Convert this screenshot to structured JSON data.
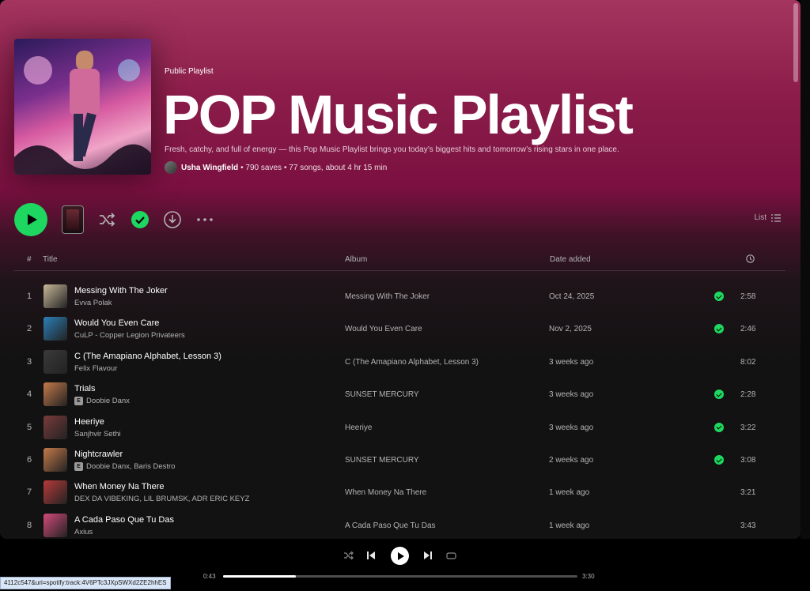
{
  "header": {
    "type_label": "Public Playlist",
    "title": "POP Music Playlist",
    "description": "Fresh, catchy, and full of energy — this Pop Music Playlist brings you today’s biggest hits and tomorrow’s rising stars in one place.",
    "owner": "Usha Wingfield",
    "saves": "• 790 saves",
    "songs": "• 77 songs, about 4 hr 15 min"
  },
  "actions": {
    "view_label": "List"
  },
  "table_head": {
    "num": "#",
    "title": "Title",
    "album": "Album",
    "date": "Date added"
  },
  "tracks": [
    {
      "num": "1",
      "name": "Messing With The Joker",
      "artist": "Evva Polak",
      "explicit": false,
      "album": "Messing With The Joker",
      "date": "Oct 24, 2025",
      "saved": true,
      "duration": "2:58",
      "thumb": "#c9b89a"
    },
    {
      "num": "2",
      "name": "Would You Even Care",
      "artist": "CuLP - Copper Legion Privateers",
      "explicit": false,
      "album": "Would You Even Care",
      "date": "Nov 2, 2025",
      "saved": true,
      "duration": "2:46",
      "thumb": "#2b7fb8"
    },
    {
      "num": "3",
      "name": "C (The Amapiano Alphabet, Lesson 3)",
      "artist": "Felix Flavour",
      "explicit": false,
      "album": "C (The Amapiano Alphabet, Lesson 3)",
      "date": "3 weeks ago",
      "saved": false,
      "duration": "8:02",
      "thumb": "#3a3a3a"
    },
    {
      "num": "4",
      "name": "Trials",
      "artist": "Doobie Danx",
      "explicit": true,
      "album": "SUNSET MERCURY",
      "date": "3 weeks ago",
      "saved": true,
      "duration": "2:28",
      "thumb": "#c47a4a"
    },
    {
      "num": "5",
      "name": "Heeriye",
      "artist": "Sanjhvir Sethi",
      "explicit": false,
      "album": "Heeriye",
      "date": "3 weeks ago",
      "saved": true,
      "duration": "3:22",
      "thumb": "#7a3b3b"
    },
    {
      "num": "6",
      "name": "Nightcrawler",
      "artist": "Doobie Danx, Baris Destro",
      "explicit": true,
      "album": "SUNSET MERCURY",
      "date": "2 weeks ago",
      "saved": true,
      "duration": "3:08",
      "thumb": "#c47a4a"
    },
    {
      "num": "7",
      "name": "When Money Na There",
      "artist": "DEX DA VIBEKING, LIL BRUMSK, ADR ERIC KEYZ",
      "explicit": false,
      "album": "When Money Na There",
      "date": "1 week ago",
      "saved": false,
      "duration": "3:21",
      "thumb": "#b83a3a"
    },
    {
      "num": "8",
      "name": "A Cada Paso Que Tu Das",
      "artist": "Axius",
      "explicit": false,
      "album": "A Cada Paso Que Tu Das",
      "date": "1 week ago",
      "saved": false,
      "duration": "3:43",
      "thumb": "#d24a7a"
    }
  ],
  "player": {
    "current_time": "0:43",
    "total_time": "3:30",
    "progress": 0.206
  },
  "status_url": "4112c547&uri=spotify:track:4V6PTc3JXpSWXd2ZE2hhES",
  "colors": {
    "accent": "#1ed760",
    "header_gradient": "#8c1d4a"
  }
}
